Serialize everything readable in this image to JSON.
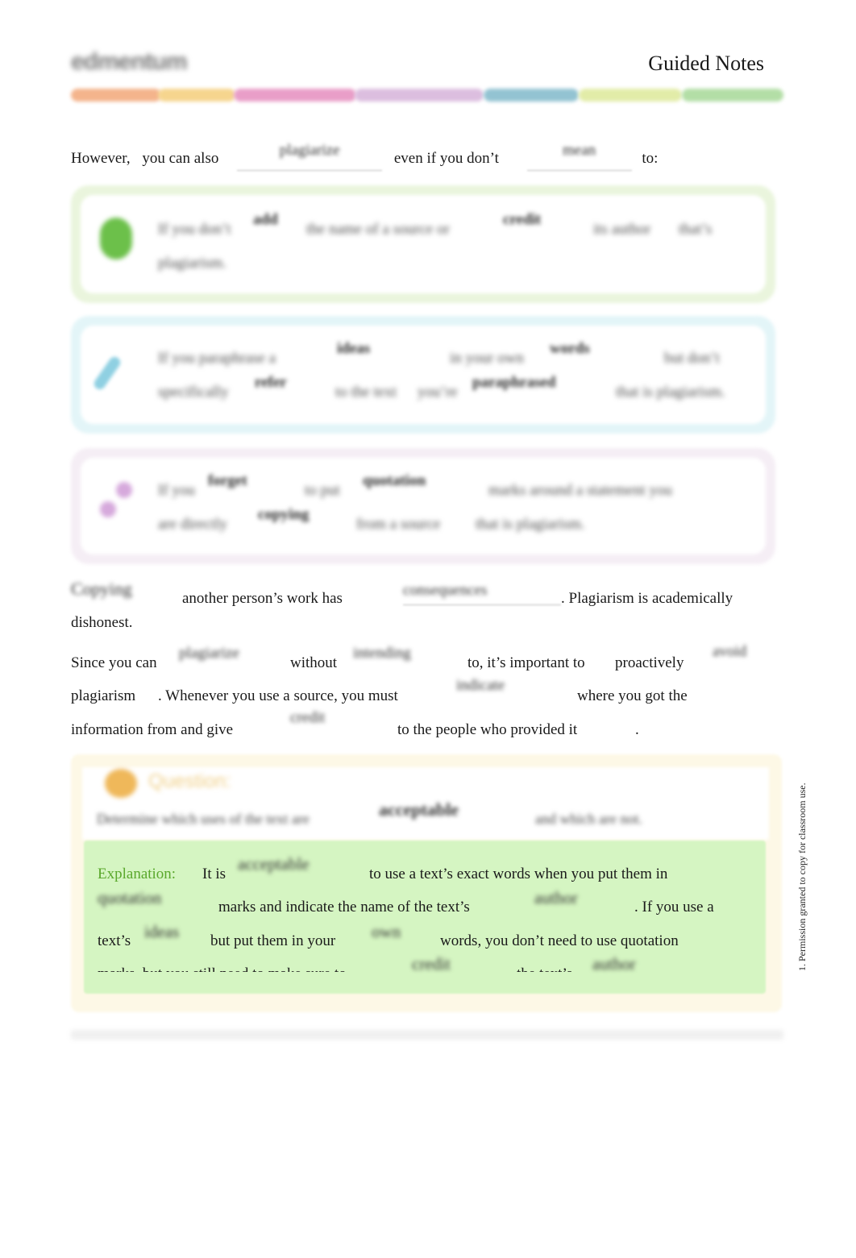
{
  "header": {
    "logo_text": "edmentum",
    "title": "Guided Notes",
    "stripe_colors": [
      "#f4b48c",
      "#f6d58e",
      "#e99ec8",
      "#dcbedf",
      "#93c3d2",
      "#e2eca8",
      "#b3dea6"
    ]
  },
  "intro": {
    "t1": "However,",
    "t2": "you can also",
    "b1": "plagiarize",
    "t3": "even if you don’t",
    "b2": "mean",
    "t4": "to:"
  },
  "cards": [
    {
      "icon": "green-button-icon",
      "color": "#6cc04a",
      "line1": {
        "t1": "If you don’t",
        "b1": "add",
        "t2": "the name of a source or",
        "b2": "credit",
        "t3": "its author",
        "t4": "that’s"
      },
      "line2": {
        "t1": "plagiarism."
      }
    },
    {
      "icon": "pencil-icon",
      "color": "#8fd0e2",
      "line1": {
        "t1": "If you paraphrase a",
        "b1": "ideas",
        "t2": "in your own",
        "b2": "words",
        "t3": "but don’t"
      },
      "line2": {
        "t1": "specifically",
        "b1": "refer",
        "t2": "to the text",
        "t3": "you’re",
        "b2": "paraphrased",
        "t4": "that is plagiarism."
      }
    },
    {
      "icon": "link-icon",
      "color": "#d6a9dc",
      "line1": {
        "t1": "If you",
        "b1": "forget",
        "t2": "to put",
        "b2": "quotation",
        "t3": "marks around a statement you"
      },
      "line2": {
        "t1": "are directly",
        "b1": "copying",
        "t2": "from a source",
        "t3": "that is plagiarism."
      }
    }
  ],
  "para1": {
    "b1": "Copying",
    "t1": "another person’s work has",
    "b2": "consequences",
    "t2": ". Plagiarism is academically",
    "t3": "dishonest."
  },
  "para2": {
    "line1": {
      "t1": "Since you can",
      "b1": "plagiarize",
      "t2": "without",
      "b2": "intending",
      "t3": "to, it’s important to",
      "t4": "proactively",
      "b3": "avoid"
    },
    "line2": {
      "t1": "plagiarism",
      "t2": ". Whenever you use a source, you must",
      "b1": "indicate",
      "t3": "where you got the"
    },
    "line3": {
      "t1": "information from and give",
      "b1": "credit",
      "t2": "to the people who provided it",
      "t3": "."
    }
  },
  "question": {
    "icon": "sun-icon",
    "heading": "Question:",
    "prompt_t1": "Determine which uses of the text are",
    "prompt_b1": "acceptable",
    "prompt_t2": "and which are not.",
    "explanation": {
      "label": "Explanation:",
      "line1": {
        "t1": "It is",
        "b1": "acceptable",
        "t2": "to use a text’s exact words when you put them in"
      },
      "line2": {
        "b1": "quotation",
        "t1": "marks and indicate the name of the text’s",
        "b2": "author",
        "t2": ". If you use a"
      },
      "line3": {
        "t1": "text’s",
        "b1": "ideas",
        "t2": "but put them in your",
        "b2": "own",
        "t3": "words, you don’t need to use quotation"
      },
      "line4": {
        "t1": "marks, but you still need to make sure to",
        "b1": "credit",
        "t2": "the text’s",
        "b2": "author"
      }
    }
  },
  "side_note": "1. Permission granted to copy for classroom use."
}
